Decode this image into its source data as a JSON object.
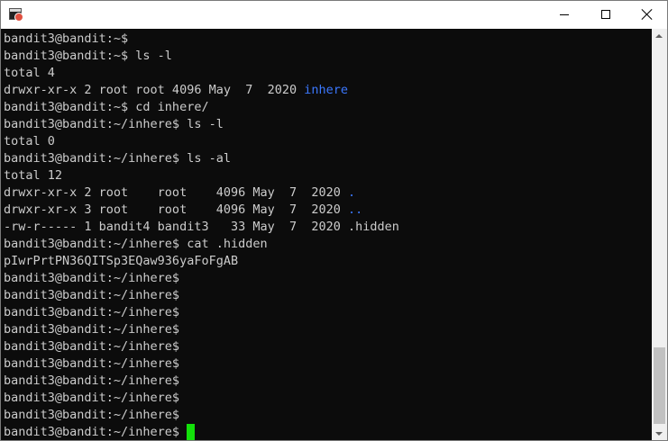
{
  "window": {
    "icon": "console-app-icon",
    "controls": [
      "minimize-icon",
      "maximize-icon",
      "close-icon"
    ]
  },
  "terminal": {
    "colors": {
      "background": "#0c0c0c",
      "text": "#cccccc",
      "directory": "#3b78ff",
      "cursor": "#13e10a"
    },
    "lines": [
      {
        "text": "bandit3@bandit:~$"
      },
      {
        "text": "bandit3@bandit:~$ ls -l"
      },
      {
        "text": "total 4"
      },
      {
        "text": "drwxr-xr-x 2 root root 4096 May  7  2020 ",
        "dir": "inhere"
      },
      {
        "text": "bandit3@bandit:~$ cd inhere/"
      },
      {
        "text": "bandit3@bandit:~/inhere$ ls -l"
      },
      {
        "text": "total 0"
      },
      {
        "text": "bandit3@bandit:~/inhere$ ls -al"
      },
      {
        "text": "total 12"
      },
      {
        "text": "drwxr-xr-x 2 root    root    4096 May  7  2020 ",
        "dir": "."
      },
      {
        "text": "drwxr-xr-x 3 root    root    4096 May  7  2020 ",
        "dir": ".."
      },
      {
        "text": "-rw-r----- 1 bandit4 bandit3   33 May  7  2020 .hidden"
      },
      {
        "text": "bandit3@bandit:~/inhere$ cat .hidden"
      },
      {
        "text": "pIwrPrtPN36QITSp3EQaw936yaFoFgAB"
      },
      {
        "text": "bandit3@bandit:~/inhere$"
      },
      {
        "text": "bandit3@bandit:~/inhere$"
      },
      {
        "text": "bandit3@bandit:~/inhere$"
      },
      {
        "text": "bandit3@bandit:~/inhere$"
      },
      {
        "text": "bandit3@bandit:~/inhere$"
      },
      {
        "text": "bandit3@bandit:~/inhere$"
      },
      {
        "text": "bandit3@bandit:~/inhere$"
      },
      {
        "text": "bandit3@bandit:~/inhere$"
      },
      {
        "text": "bandit3@bandit:~/inhere$"
      },
      {
        "text": "bandit3@bandit:~/inhere$ ",
        "cursor": true
      }
    ]
  }
}
